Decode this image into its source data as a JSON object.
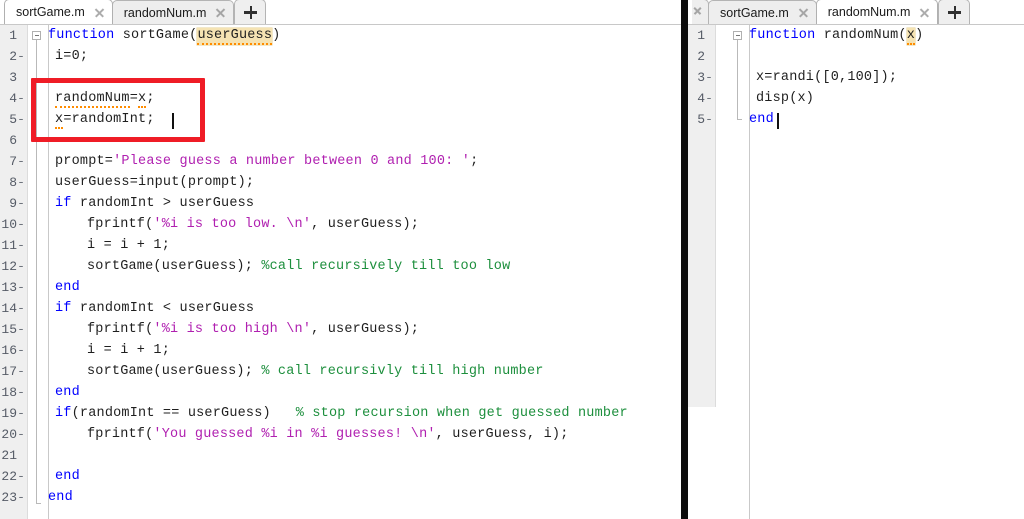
{
  "left_panel": {
    "tabs": [
      {
        "label": "sortGame.m",
        "active": true,
        "close_icon": "close-icon"
      },
      {
        "label": "randomNum.m",
        "active": false,
        "close_icon": "close-icon"
      }
    ],
    "new_tab_icon": "plus-icon",
    "file": "sortGame.m",
    "lines": [
      {
        "n": "1",
        "exec": "",
        "indent": 0
      },
      {
        "n": "2",
        "exec": "-",
        "indent": 1
      },
      {
        "n": "3",
        "exec": "",
        "indent": 0
      },
      {
        "n": "4",
        "exec": "-",
        "indent": 1
      },
      {
        "n": "5",
        "exec": "-",
        "indent": 1
      },
      {
        "n": "6",
        "exec": "",
        "indent": 0
      },
      {
        "n": "7",
        "exec": "-",
        "indent": 1
      },
      {
        "n": "8",
        "exec": "-",
        "indent": 1
      },
      {
        "n": "9",
        "exec": "-",
        "indent": 1
      },
      {
        "n": "10",
        "exec": "-",
        "indent": 2
      },
      {
        "n": "11",
        "exec": "-",
        "indent": 2
      },
      {
        "n": "12",
        "exec": "-",
        "indent": 2
      },
      {
        "n": "13",
        "exec": "-",
        "indent": 1
      },
      {
        "n": "14",
        "exec": "-",
        "indent": 1
      },
      {
        "n": "15",
        "exec": "-",
        "indent": 2
      },
      {
        "n": "16",
        "exec": "-",
        "indent": 2
      },
      {
        "n": "17",
        "exec": "-",
        "indent": 2
      },
      {
        "n": "18",
        "exec": "-",
        "indent": 1
      },
      {
        "n": "19",
        "exec": "-",
        "indent": 1
      },
      {
        "n": "20",
        "exec": "-",
        "indent": 2
      },
      {
        "n": "21",
        "exec": "",
        "indent": 0
      },
      {
        "n": "22",
        "exec": "-",
        "indent": 1
      },
      {
        "n": "23",
        "exec": "-",
        "indent": 0
      }
    ],
    "code": {
      "l1_function": "function",
      "l1_name": " sortGame(",
      "l1_arg": "userGuess",
      "l1_close": ")",
      "l2": "i=0;",
      "l4_a": "randomNum",
      "l4_b": "=",
      "l4_c": "x",
      "l4_d": ";",
      "l5_a": "x",
      "l5_b": "=randomInt;",
      "l7_a": "prompt=",
      "l7_str": "'Please guess a number between 0 and 100: '",
      "l7_b": ";",
      "l8": "userGuess=input(prompt);",
      "l9_kw": "if",
      "l9_rest": " randomInt > userGuess",
      "l10_a": "fprintf(",
      "l10_str": "'%i is too low. \\n'",
      "l10_b": ", userGuess);",
      "l11": "i = i + 1;",
      "l12_a": "sortGame(userGuess); ",
      "l12_cmt": "%call recursively till too low",
      "l13_kw": "end",
      "l14_kw": "if",
      "l14_rest": " randomInt < userGuess",
      "l15_a": "fprintf(",
      "l15_str": "'%i is too high \\n'",
      "l15_b": ", userGuess);",
      "l16": "i = i + 1;",
      "l17_a": "sortGame(userGuess); ",
      "l17_cmt": "% call recursivly till high number",
      "l18_kw": "end",
      "l19_kw": "if",
      "l19_rest": "(randomInt == userGuess)   ",
      "l19_cmt": "% stop recursion when get guessed number",
      "l20_a": "fprintf(",
      "l20_str": "'You guessed %i in %i guesses! \\n'",
      "l20_b": ", userGuess, i);",
      "l22_kw": "end",
      "l23_kw": "end"
    },
    "annotation": {
      "shape": "rectangle",
      "color": "#ef1c26",
      "covers_lines": "4-5"
    }
  },
  "right_panel": {
    "tabs": [
      {
        "label": "sortGame.m",
        "active": false,
        "close_icon": "close-icon"
      },
      {
        "label": "randomNum.m",
        "active": true,
        "close_icon": "close-icon"
      }
    ],
    "new_tab_icon": "plus-icon",
    "file": "randomNum.m",
    "lines": [
      {
        "n": "1",
        "exec": "",
        "indent": 0
      },
      {
        "n": "2",
        "exec": "",
        "indent": 0
      },
      {
        "n": "3",
        "exec": "-",
        "indent": 1
      },
      {
        "n": "4",
        "exec": "-",
        "indent": 1
      },
      {
        "n": "5",
        "exec": "-",
        "indent": 0
      }
    ],
    "code": {
      "l1_function": "function",
      "l1_name": " randomNum(",
      "l1_arg": "x",
      "l1_close": ")",
      "l3": "x=randi([0,100]);",
      "l4": "disp(x)",
      "l5_kw": "end"
    }
  },
  "colors": {
    "keyword": "#0000ff",
    "string": "#b020b0",
    "comment": "#1d8f3d",
    "annotation": "#ef1c26",
    "var_highlight": "#f5e3b3",
    "warning_underline": "#ff8c00",
    "gutter_bg": "#efefef",
    "splitter": "#0b0b0b"
  }
}
